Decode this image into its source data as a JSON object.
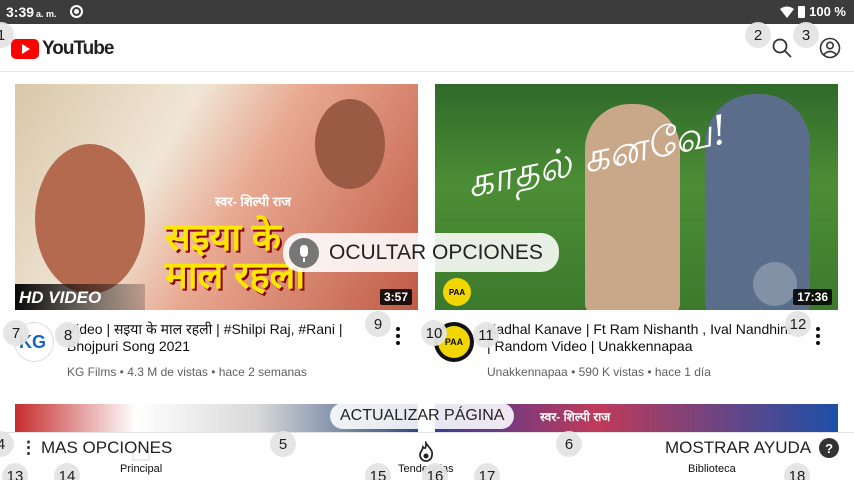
{
  "status_bar": {
    "time": "3:39",
    "ampm": "a. m.",
    "battery": "100 %"
  },
  "app": {
    "name": "YouTube"
  },
  "header": {
    "search_icon": "search-icon",
    "account_icon": "account-icon"
  },
  "videos": [
    {
      "thumb_credit": "स्वर- शिल्पी राज",
      "thumb_text_line1": "सइया के",
      "thumb_text_line2": "माल रहला",
      "thumb_badge": "HD VIDEO",
      "duration": "3:57",
      "title": "Video | सइया के माल रहली | #Shilpi Raj, #Rani | Bhojpuri Song 2021",
      "channel": "KG Films",
      "views": "4.3 M de vistas",
      "age": "hace 2 semanas",
      "avatar_text": "KG"
    },
    {
      "thumb_text": "காதல் கனவே!",
      "thumb_logo": "PAA",
      "duration": "17:36",
      "title": "Kadhal Kanave | Ft Ram Nishanth , Ival Nandhini | Random Video | Unakkennapaa",
      "channel": "Unakkennapaa",
      "views": "590 K vistas",
      "age": "hace 1 día",
      "avatar_text": "PAA"
    }
  ],
  "row2": {
    "thumb4_credit": "स्वर- शिल्पी राज"
  },
  "overlays": {
    "hide_options": "OCULTAR OPCIONES",
    "refresh_page": "ACTUALIZAR PÁGINA",
    "more_options": "MAS OPCIONES",
    "show_help": "MOSTRAR AYUDA",
    "help_symbol": "?"
  },
  "bottom_nav": {
    "home": "Principal",
    "trending": "Tendencias",
    "library": "Biblioteca"
  },
  "badges": [
    "1",
    "2",
    "3",
    "4",
    "5",
    "6",
    "7",
    "8",
    "9",
    "10",
    "11",
    "12",
    "13",
    "14",
    "15",
    "16",
    "17",
    "18"
  ],
  "colors": {
    "brand_red": "#ff0000",
    "status_bar": "#3c3c3c",
    "meta_gray": "#606060"
  }
}
